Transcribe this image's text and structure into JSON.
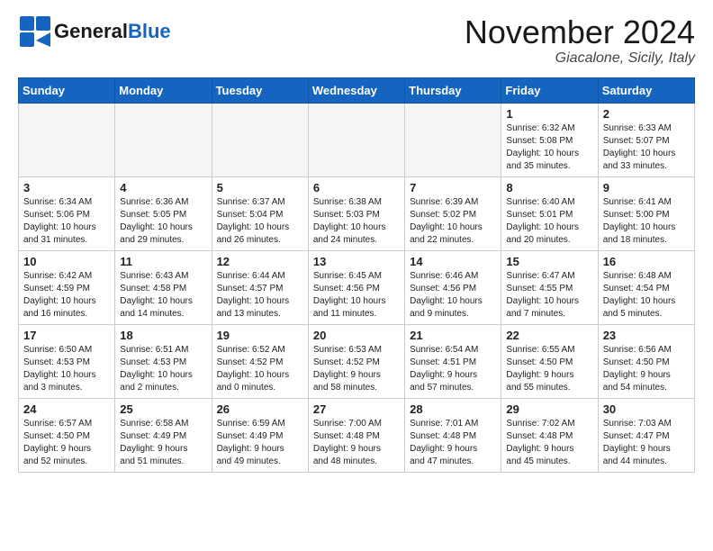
{
  "header": {
    "logo_general": "General",
    "logo_blue": "Blue",
    "month_title": "November 2024",
    "location": "Giacalone, Sicily, Italy"
  },
  "days_of_week": [
    "Sunday",
    "Monday",
    "Tuesday",
    "Wednesday",
    "Thursday",
    "Friday",
    "Saturday"
  ],
  "weeks": [
    [
      {
        "date": "",
        "info": ""
      },
      {
        "date": "",
        "info": ""
      },
      {
        "date": "",
        "info": ""
      },
      {
        "date": "",
        "info": ""
      },
      {
        "date": "",
        "info": ""
      },
      {
        "date": "1",
        "info": "Sunrise: 6:32 AM\nSunset: 5:08 PM\nDaylight: 10 hours\nand 35 minutes."
      },
      {
        "date": "2",
        "info": "Sunrise: 6:33 AM\nSunset: 5:07 PM\nDaylight: 10 hours\nand 33 minutes."
      }
    ],
    [
      {
        "date": "3",
        "info": "Sunrise: 6:34 AM\nSunset: 5:06 PM\nDaylight: 10 hours\nand 31 minutes."
      },
      {
        "date": "4",
        "info": "Sunrise: 6:36 AM\nSunset: 5:05 PM\nDaylight: 10 hours\nand 29 minutes."
      },
      {
        "date": "5",
        "info": "Sunrise: 6:37 AM\nSunset: 5:04 PM\nDaylight: 10 hours\nand 26 minutes."
      },
      {
        "date": "6",
        "info": "Sunrise: 6:38 AM\nSunset: 5:03 PM\nDaylight: 10 hours\nand 24 minutes."
      },
      {
        "date": "7",
        "info": "Sunrise: 6:39 AM\nSunset: 5:02 PM\nDaylight: 10 hours\nand 22 minutes."
      },
      {
        "date": "8",
        "info": "Sunrise: 6:40 AM\nSunset: 5:01 PM\nDaylight: 10 hours\nand 20 minutes."
      },
      {
        "date": "9",
        "info": "Sunrise: 6:41 AM\nSunset: 5:00 PM\nDaylight: 10 hours\nand 18 minutes."
      }
    ],
    [
      {
        "date": "10",
        "info": "Sunrise: 6:42 AM\nSunset: 4:59 PM\nDaylight: 10 hours\nand 16 minutes."
      },
      {
        "date": "11",
        "info": "Sunrise: 6:43 AM\nSunset: 4:58 PM\nDaylight: 10 hours\nand 14 minutes."
      },
      {
        "date": "12",
        "info": "Sunrise: 6:44 AM\nSunset: 4:57 PM\nDaylight: 10 hours\nand 13 minutes."
      },
      {
        "date": "13",
        "info": "Sunrise: 6:45 AM\nSunset: 4:56 PM\nDaylight: 10 hours\nand 11 minutes."
      },
      {
        "date": "14",
        "info": "Sunrise: 6:46 AM\nSunset: 4:56 PM\nDaylight: 10 hours\nand 9 minutes."
      },
      {
        "date": "15",
        "info": "Sunrise: 6:47 AM\nSunset: 4:55 PM\nDaylight: 10 hours\nand 7 minutes."
      },
      {
        "date": "16",
        "info": "Sunrise: 6:48 AM\nSunset: 4:54 PM\nDaylight: 10 hours\nand 5 minutes."
      }
    ],
    [
      {
        "date": "17",
        "info": "Sunrise: 6:50 AM\nSunset: 4:53 PM\nDaylight: 10 hours\nand 3 minutes."
      },
      {
        "date": "18",
        "info": "Sunrise: 6:51 AM\nSunset: 4:53 PM\nDaylight: 10 hours\nand 2 minutes."
      },
      {
        "date": "19",
        "info": "Sunrise: 6:52 AM\nSunset: 4:52 PM\nDaylight: 10 hours\nand 0 minutes."
      },
      {
        "date": "20",
        "info": "Sunrise: 6:53 AM\nSunset: 4:52 PM\nDaylight: 9 hours\nand 58 minutes."
      },
      {
        "date": "21",
        "info": "Sunrise: 6:54 AM\nSunset: 4:51 PM\nDaylight: 9 hours\nand 57 minutes."
      },
      {
        "date": "22",
        "info": "Sunrise: 6:55 AM\nSunset: 4:50 PM\nDaylight: 9 hours\nand 55 minutes."
      },
      {
        "date": "23",
        "info": "Sunrise: 6:56 AM\nSunset: 4:50 PM\nDaylight: 9 hours\nand 54 minutes."
      }
    ],
    [
      {
        "date": "24",
        "info": "Sunrise: 6:57 AM\nSunset: 4:50 PM\nDaylight: 9 hours\nand 52 minutes."
      },
      {
        "date": "25",
        "info": "Sunrise: 6:58 AM\nSunset: 4:49 PM\nDaylight: 9 hours\nand 51 minutes."
      },
      {
        "date": "26",
        "info": "Sunrise: 6:59 AM\nSunset: 4:49 PM\nDaylight: 9 hours\nand 49 minutes."
      },
      {
        "date": "27",
        "info": "Sunrise: 7:00 AM\nSunset: 4:48 PM\nDaylight: 9 hours\nand 48 minutes."
      },
      {
        "date": "28",
        "info": "Sunrise: 7:01 AM\nSunset: 4:48 PM\nDaylight: 9 hours\nand 47 minutes."
      },
      {
        "date": "29",
        "info": "Sunrise: 7:02 AM\nSunset: 4:48 PM\nDaylight: 9 hours\nand 45 minutes."
      },
      {
        "date": "30",
        "info": "Sunrise: 7:03 AM\nSunset: 4:47 PM\nDaylight: 9 hours\nand 44 minutes."
      }
    ]
  ]
}
